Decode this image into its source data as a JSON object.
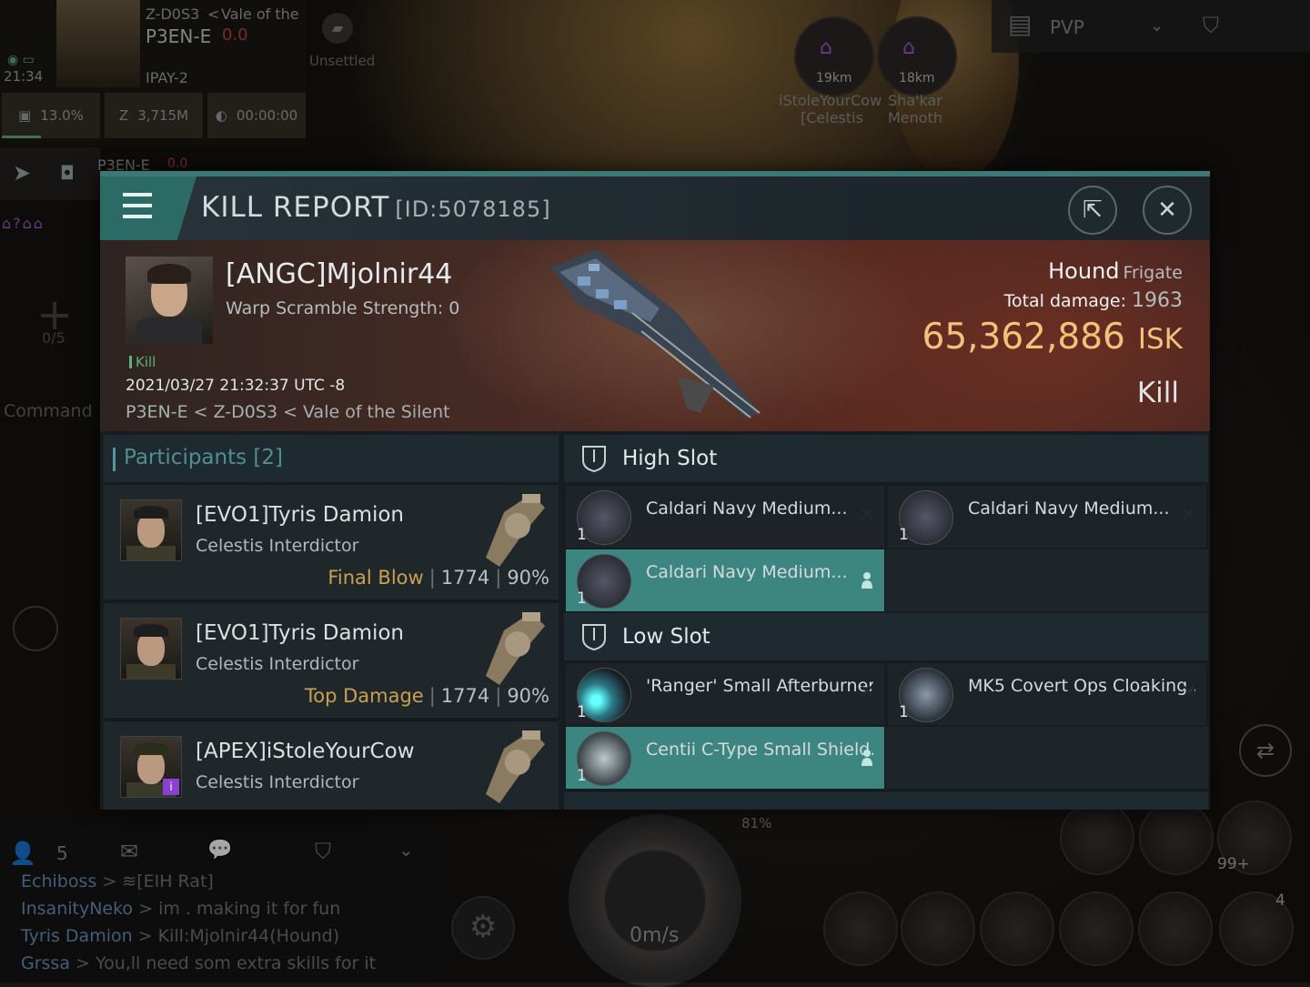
{
  "hud": {
    "system": "Z-D0S3",
    "region_prefix": "<",
    "region": "Vale of the",
    "location": "P3EN-E",
    "security": "0.0",
    "time": "21:34",
    "corp": "IPAY-2",
    "status": "Unsettled",
    "cargo": "13.0%",
    "wallet": "3,715M",
    "timer": "00:00:00",
    "nav_location": "P3EN-E",
    "nav_sec": "0.0",
    "add_count": "0/5",
    "command_label": "Command >",
    "filter_label": "PVP",
    "targets": [
      {
        "distance": "19km",
        "name": "iStoleYourCow",
        "ship": "[Celestis"
      },
      {
        "distance": "18km",
        "name": "Sha'kar",
        "ship": "Menoth"
      }
    ]
  },
  "chat": {
    "count": "5",
    "lines": [
      {
        "name": "Echiboss",
        "msg": "> ≋[EIH Rat]"
      },
      {
        "name": "InsanityNeko",
        "msg": "> im . making it for fun"
      },
      {
        "name": "Tyris Damion",
        "msg": "> Kill:Mjolnir44(Hound)"
      },
      {
        "name": "Grssa",
        "msg": "> You,ll need som extra skills for it"
      }
    ]
  },
  "bottom": {
    "speed": "0m/s",
    "capacitor": "81%",
    "ammo_count": "99+",
    "drone_count": "4"
  },
  "report": {
    "title": "KILL REPORT",
    "id": "[ID:5078185]",
    "victim": {
      "name": "[ANGC]Mjolnir44",
      "warp": "Warp Scramble Strength: 0",
      "type": "Kill",
      "datetime": "2021/03/27 21:32:37 UTC -8",
      "location": "P3EN-E < Z-D0S3 < Vale of the Silent"
    },
    "ship": {
      "name": "Hound",
      "class": "Frigate",
      "damage_label": "Total damage:",
      "damage": "1963",
      "isk": "65,362,886",
      "isk_unit": "ISK",
      "result": "Kill"
    },
    "participants_label": "Participants",
    "participants_count": "[2]",
    "participants": [
      {
        "name": "[EVO1]Tyris Damion",
        "ship": "Celestis Interdictor",
        "tag": "Final Blow",
        "damage": "1774",
        "pct": "90%"
      },
      {
        "name": "[EVO1]Tyris Damion",
        "ship": "Celestis Interdictor",
        "tag": "Top Damage",
        "damage": "1774",
        "pct": "90%"
      },
      {
        "name": "[APEX]iStoleYourCow",
        "ship": "Celestis Interdictor",
        "tag": "",
        "damage": "",
        "pct": ""
      }
    ],
    "high_slot_label": "High Slot",
    "high_slots": [
      {
        "name": "Caldari Navy Medium...",
        "qty": "1",
        "state": "destroyed"
      },
      {
        "name": "Caldari Navy Medium...",
        "qty": "1",
        "state": "destroyed"
      },
      {
        "name": "Caldari Navy Medium...",
        "qty": "1",
        "state": "dropped"
      }
    ],
    "low_slot_label": "Low Slot",
    "low_slots": [
      {
        "name": "'Ranger' Small Afterburner",
        "qty": "1",
        "state": "destroyed"
      },
      {
        "name": "MK5 Covert Ops Cloaking...",
        "qty": "1",
        "state": "destroyed"
      },
      {
        "name": "Centii C-Type Small Shield...",
        "qty": "1",
        "state": "dropped"
      }
    ],
    "colors": {
      "accent": "#3c8580",
      "isk": "#f4c07a",
      "final_blow": "#c8a050"
    }
  }
}
